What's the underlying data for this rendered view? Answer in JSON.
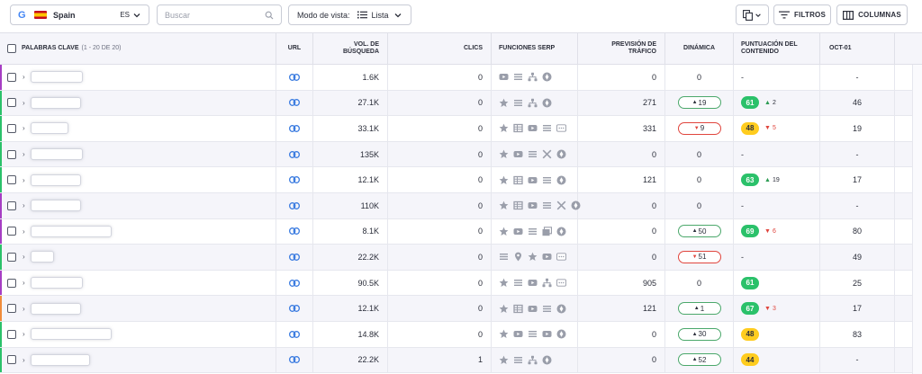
{
  "toolbar": {
    "database": {
      "engine_icon": "G",
      "country": "Spain",
      "language": "ES"
    },
    "search": {
      "placeholder": "Buscar",
      "value": ""
    },
    "view_mode": {
      "label": "Modo de vista:",
      "value": "Lista"
    },
    "filters_label": "FILTROS",
    "columns_label": "COLUMNAS"
  },
  "table": {
    "headers": {
      "keyword": "PALABRAS CLAVE",
      "keyword_range": "(1 - 20 DE 20)",
      "url": "URL",
      "volume": "VOL. DE BÚSQUEDA",
      "clicks": "CLICS",
      "serp": "FUNCIONES SERP",
      "traffic": "PREVISIÓN DE TRÁFICO",
      "dynamics": "DINÁMICA",
      "content_score": "PUNTUACIÓN DEL CONTENIDO",
      "oct": "OCT-01"
    },
    "rows": [
      {
        "accent": "#a63ec3",
        "volume": "1.6K",
        "clicks": "0",
        "serp": [
          "youtube-icon",
          "list-icon",
          "sitemap-icon",
          "knowledge-icon"
        ],
        "traffic": "0",
        "dyn": {
          "type": "plain",
          "value": "0"
        },
        "score": null,
        "score_color": "",
        "score_delta": null,
        "score_dir": "",
        "score_text": "-",
        "oct": "-"
      },
      {
        "accent": "#2bc16a",
        "volume": "27.1K",
        "clicks": "0",
        "serp": [
          "star-icon",
          "list-icon",
          "sitemap-icon",
          "knowledge-icon"
        ],
        "traffic": "271",
        "dyn": {
          "type": "up",
          "value": "19"
        },
        "score": "61",
        "score_color": "green",
        "score_delta": "2",
        "score_dir": "up",
        "score_text": "",
        "oct": "46"
      },
      {
        "accent": "#2bc16a",
        "volume": "33.1K",
        "clicks": "0",
        "serp": [
          "star-icon",
          "table-icon",
          "youtube-icon",
          "list-icon",
          "more-icon"
        ],
        "traffic": "331",
        "dyn": {
          "type": "down",
          "value": "9"
        },
        "score": "48",
        "score_color": "yellow",
        "score_delta": "5",
        "score_dir": "down",
        "score_text": "",
        "oct": "19"
      },
      {
        "accent": "#2bc16a",
        "volume": "135K",
        "clicks": "0",
        "serp": [
          "star-icon",
          "youtube-icon",
          "list-icon",
          "x-icon",
          "knowledge-icon"
        ],
        "traffic": "0",
        "dyn": {
          "type": "plain",
          "value": "0"
        },
        "score": null,
        "score_color": "",
        "score_delta": null,
        "score_dir": "",
        "score_text": "-",
        "oct": "-"
      },
      {
        "accent": "#2bc16a",
        "volume": "12.1K",
        "clicks": "0",
        "serp": [
          "star-icon",
          "table-icon",
          "youtube-icon",
          "list-icon",
          "knowledge-icon"
        ],
        "traffic": "121",
        "dyn": {
          "type": "plain",
          "value": "0"
        },
        "score": "63",
        "score_color": "green",
        "score_delta": "19",
        "score_dir": "up",
        "score_text": "",
        "oct": "17"
      },
      {
        "accent": "#a63ec3",
        "volume": "110K",
        "clicks": "0",
        "serp": [
          "star-icon",
          "table-icon",
          "youtube-icon",
          "list-icon",
          "x-icon",
          "knowledge-icon"
        ],
        "traffic": "0",
        "dyn": {
          "type": "plain",
          "value": "0"
        },
        "score": null,
        "score_color": "",
        "score_delta": null,
        "score_dir": "",
        "score_text": "-",
        "oct": "-"
      },
      {
        "accent": "#a63ec3",
        "volume": "8.1K",
        "clicks": "0",
        "serp": [
          "star-icon",
          "youtube-icon",
          "list-icon",
          "images-icon",
          "knowledge-icon"
        ],
        "traffic": "0",
        "dyn": {
          "type": "up",
          "value": "50"
        },
        "score": "69",
        "score_color": "green",
        "score_delta": "6",
        "score_dir": "down",
        "score_text": "",
        "oct": "80"
      },
      {
        "accent": "#2bc16a",
        "volume": "22.2K",
        "clicks": "0",
        "serp": [
          "list-icon",
          "pin-icon",
          "star-icon",
          "youtube-icon",
          "more-icon"
        ],
        "traffic": "0",
        "dyn": {
          "type": "down",
          "value": "51"
        },
        "score": null,
        "score_color": "",
        "score_delta": null,
        "score_dir": "",
        "score_text": "-",
        "oct": "49"
      },
      {
        "accent": "#a63ec3",
        "volume": "90.5K",
        "clicks": "0",
        "serp": [
          "star-icon",
          "list-icon",
          "youtube-icon",
          "sitemap-icon",
          "more-icon"
        ],
        "traffic": "905",
        "dyn": {
          "type": "plain",
          "value": "0"
        },
        "score": "61",
        "score_color": "green",
        "score_delta": null,
        "score_dir": "",
        "score_text": "",
        "oct": "25"
      },
      {
        "accent": "#f08b3a",
        "volume": "12.1K",
        "clicks": "0",
        "serp": [
          "star-icon",
          "table-icon",
          "youtube-icon",
          "list-icon",
          "knowledge-icon"
        ],
        "traffic": "121",
        "dyn": {
          "type": "up",
          "value": "1"
        },
        "score": "67",
        "score_color": "green",
        "score_delta": "3",
        "score_dir": "down",
        "score_text": "",
        "oct": "17"
      },
      {
        "accent": "#2bc16a",
        "volume": "14.8K",
        "clicks": "0",
        "serp": [
          "star-icon",
          "youtube-icon",
          "list-icon",
          "youtube-icon",
          "knowledge-icon"
        ],
        "traffic": "0",
        "dyn": {
          "type": "up",
          "value": "30"
        },
        "score": "48",
        "score_color": "yellow",
        "score_delta": null,
        "score_dir": "",
        "score_text": "",
        "oct": "83"
      },
      {
        "accent": "#2bc16a",
        "volume": "22.2K",
        "clicks": "1",
        "serp": [
          "star-icon",
          "list-icon",
          "sitemap-icon",
          "knowledge-icon"
        ],
        "traffic": "0",
        "dyn": {
          "type": "up",
          "value": "52"
        },
        "score": "44",
        "score_color": "yellow",
        "score_delta": null,
        "score_dir": "",
        "score_text": "",
        "oct": "-"
      }
    ]
  }
}
